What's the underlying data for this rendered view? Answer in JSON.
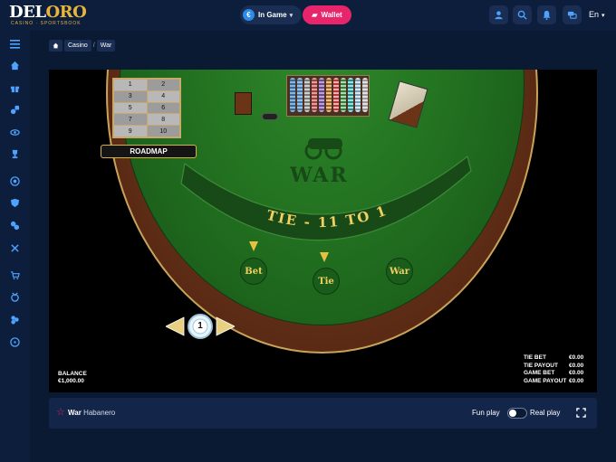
{
  "header": {
    "logo_text_a": "DEL",
    "logo_text_b": "ORO",
    "logo_sub": "CASINO · SPORTSBOOK",
    "mode_label": "In Game",
    "wallet_label": "Wallet",
    "language": "En"
  },
  "sidebar": {
    "items": [
      "menu-icon",
      "home-icon",
      "gift-icon",
      "casino-icon",
      "eye-icon",
      "trophy-icon",
      "live-icon",
      "shield-icon",
      "chips-icon",
      "tools-icon",
      "cart-icon",
      "badge-icon",
      "coins-icon",
      "support-icon"
    ]
  },
  "breadcrumb": {
    "home_icon": "home-icon",
    "items": [
      "Casino",
      "War"
    ]
  },
  "game": {
    "roadmap": [
      "1",
      "2",
      "3",
      "4",
      "5",
      "6",
      "7",
      "8",
      "9",
      "10"
    ],
    "roadmap_label": "ROADMAP",
    "war_title": "WAR",
    "tie_text": "TIE - 11 TO 1",
    "bet_label": "Bet",
    "tie_label": "Tie",
    "war_label": "War",
    "chip_value": "1",
    "balance_label": "BALANCE",
    "balance_value": "€1,000.00",
    "stats": [
      {
        "label": "TIE BET",
        "value": "€0.00"
      },
      {
        "label": "TIE PAYOUT",
        "value": "€0.00"
      },
      {
        "label": "GAME BET",
        "value": "€0.00"
      },
      {
        "label": "GAME PAYOUT",
        "value": "€0.00"
      }
    ]
  },
  "infobar": {
    "game_name": "War",
    "provider": "Habanero",
    "fun_play": "Fun play",
    "real_play": "Real play"
  },
  "colors": {
    "accent_pink": "#e8246b",
    "bg": "#0b1a33",
    "felt": "#1f6a1e",
    "gold": "#e8c040"
  }
}
